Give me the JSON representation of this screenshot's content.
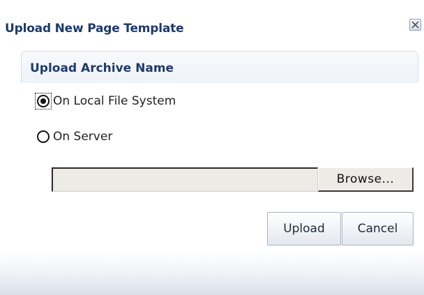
{
  "dialog": {
    "title": "Upload New Page Template",
    "close_icon": "close-x-icon"
  },
  "section": {
    "title": "Upload Archive Name"
  },
  "options": [
    {
      "label": "On Local File System",
      "selected": true
    },
    {
      "label": "On Server",
      "selected": false
    }
  ],
  "file_input": {
    "value": ""
  },
  "buttons": {
    "browse": "Browse...",
    "upload": "Upload",
    "cancel": "Cancel"
  },
  "colors": {
    "title_text": "#1c3a6d",
    "button_border": "#aab4c2"
  }
}
